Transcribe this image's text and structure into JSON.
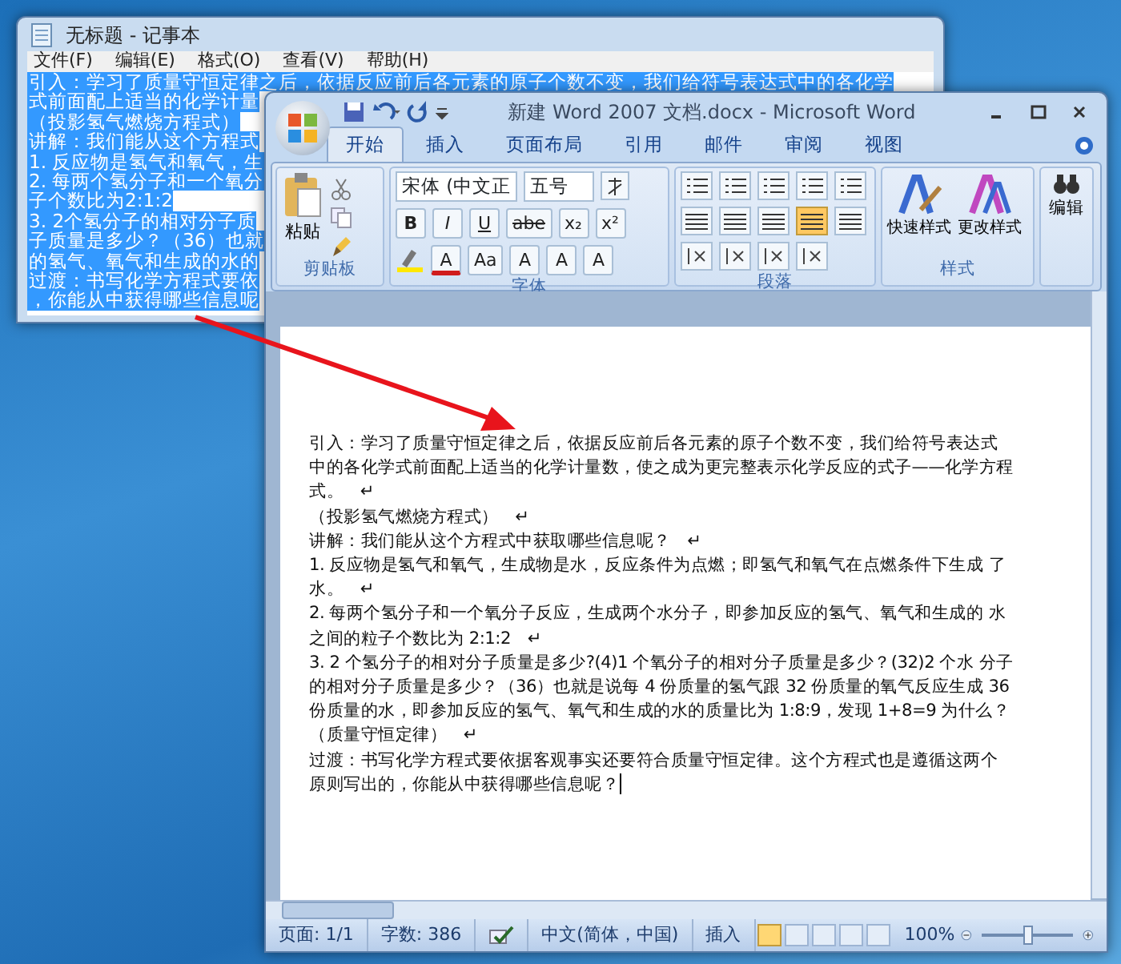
{
  "notepad": {
    "title": "无标题 - 记事本",
    "menu": [
      "文件(F)",
      "编辑(E)",
      "格式(O)",
      "查看(V)",
      "帮助(H)"
    ],
    "lines": [
      {
        "text": "引入：学习了质量守恒定律之后，依据反应前后各元素的原子个数不变，我们给符号表达式中的各化学",
        "selected": true
      },
      {
        "text": "式前面配上适当的化学计量",
        "selected": true
      },
      {
        "text": "（投影氢气燃烧方程式）",
        "selected": true
      },
      {
        "text": "讲解：我们能从这个方程式",
        "selected": true
      },
      {
        "text": "1. 反应物是氢气和氧气，生",
        "selected": true
      },
      {
        "text": "2. 每两个氢分子和一个氧分",
        "selected": true
      },
      {
        "text": "子个数比为2:1:2",
        "selected": true
      },
      {
        "text": "3. 2个氢分子的相对分子质",
        "selected": true
      },
      {
        "text": "子质量是多少？（36）也就",
        "selected": true
      },
      {
        "text": "的氢气、氧气和生成的水的",
        "selected": true
      },
      {
        "text": "过渡：书写化学方程式要依",
        "selected": true
      },
      {
        "text": "，你能从中获得哪些信息呢",
        "selected": true
      }
    ]
  },
  "word": {
    "title": "新建 Word 2007 文档.docx - Microsoft Word",
    "tabs": [
      {
        "label": "开始",
        "selected": true
      },
      {
        "label": "插入",
        "selected": false
      },
      {
        "label": "页面布局",
        "selected": false
      },
      {
        "label": "引用",
        "selected": false
      },
      {
        "label": "邮件",
        "selected": false
      },
      {
        "label": "审阅",
        "selected": false
      },
      {
        "label": "视图",
        "selected": false
      }
    ],
    "ribbon": {
      "paste": "粘贴",
      "clipboard_label": "剪贴板",
      "font_name": "宋体 (中文正",
      "font_size": "五号",
      "font_buttons": [
        "B",
        "I",
        "U",
        "abe",
        "x₂",
        "x²"
      ],
      "font_buttons_2": [
        "A",
        "Aa",
        "A",
        "A",
        "A"
      ],
      "font_label": "字体",
      "paragraph_align": [
        {
          "selected": false
        },
        {
          "selected": false
        },
        {
          "selected": false
        },
        {
          "selected": true
        },
        {
          "selected": false
        }
      ],
      "paragraph_label": "段落",
      "styles": [
        "快速样式",
        "更改样式"
      ],
      "styles_label": "样式",
      "edit": "编辑"
    },
    "document": {
      "paragraphs": [
        {
          "text": "引入：学习了质量守恒定律之后，依据反应前后各元素的原子个数不变，我们给符号表达式中的各化学式前面配上适当的化学计量数，使之成为更完整表示化学反应的式子——化学方程式。",
          "end_mark": "↵"
        },
        {
          "text": "（投影氢气燃烧方程式）",
          "end_mark": "↵"
        },
        {
          "text": "讲解：我们能从这个方程式中获取哪些信息呢？",
          "end_mark": "↵"
        },
        {
          "text": "1. 反应物是氢气和氧气，生成物是水，反应条件为点燃；即氢气和氧气在点燃条件下生成 了水。",
          "end_mark": "↵"
        },
        {
          "text": "2. 每两个氢分子和一个氧分子反应，生成两个水分子，即参加反应的氢气、氧气和生成的 水之间的粒子个数比为 2:1:2",
          "end_mark": "↵"
        },
        {
          "text": "3. 2 个氢分子的相对分子质量是多少?(4)1 个氧分子的相对分子质量是多少？(32)2 个水 分子的相对分子质量是多少？（36）也就是说每 4 份质量的氢气跟 32 份质量的氧气反应生成 36 份质量的水，即参加反应的氢气、氧气和生成的水的质量比为 1:8:9，发现 1+8=9 为什么？（质量守恒定律）",
          "end_mark": "↵"
        },
        {
          "text": "过渡：书写化学方程式要依据客观事实还要符合质量守恒定律。这个方程式也是遵循这两个原则写出的，你能从中获得哪些信息呢？"
        }
      ]
    },
    "status_bar": {
      "page": "页面: 1/1",
      "words": "字数: 386",
      "language": "中文(简体，中国)",
      "mode": "插入",
      "views": [
        {
          "selected": true
        },
        {
          "selected": false
        },
        {
          "selected": false
        },
        {
          "selected": false
        },
        {
          "selected": false
        }
      ],
      "zoom": "100%",
      "level": 0.5
    }
  }
}
